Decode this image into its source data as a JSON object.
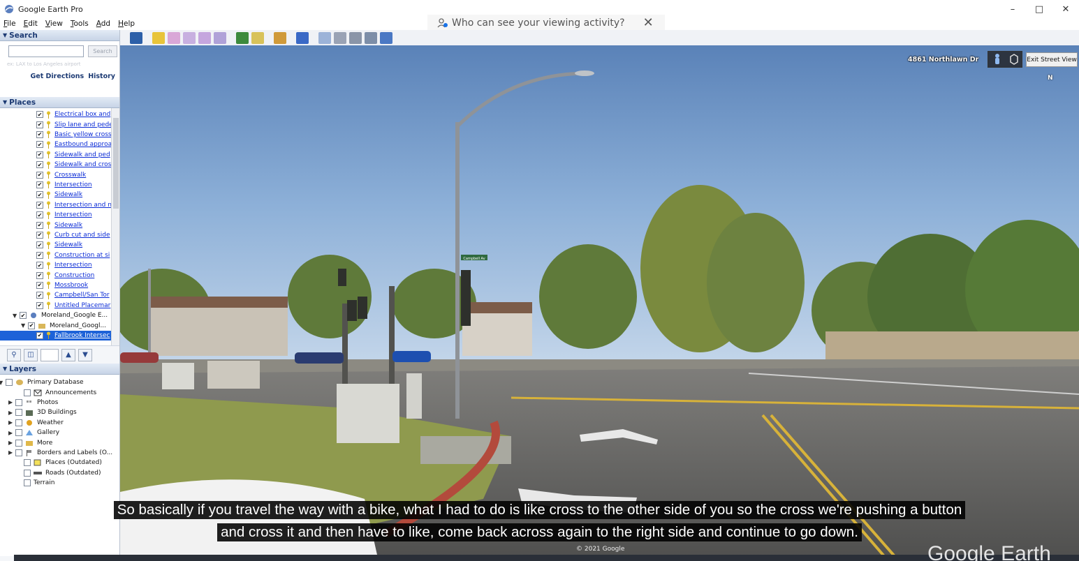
{
  "window": {
    "title": "Google Earth Pro",
    "controls": [
      "–",
      "□",
      "✕"
    ]
  },
  "menu": [
    {
      "u": "F",
      "rest": "ile"
    },
    {
      "u": "E",
      "rest": "dit"
    },
    {
      "u": "V",
      "rest": "iew"
    },
    {
      "u": "T",
      "rest": "ools"
    },
    {
      "u": "A",
      "rest": "dd"
    },
    {
      "u": "H",
      "rest": "elp"
    }
  ],
  "notice": {
    "text": "Who can see your viewing activity?",
    "close": "✕"
  },
  "search": {
    "header": "Search",
    "button": "Search",
    "hint": "ex: LAX to Los Angeles airport",
    "links": [
      "Get Directions",
      "History"
    ]
  },
  "places": {
    "header": "Places",
    "items": [
      "Electrical box and",
      "Slip lane and pede",
      "Basic yellow cross",
      "Eastbound approa",
      "Sidewalk and ped",
      "Sidewalk and cros",
      "Crosswalk",
      "Intersection",
      "Sidewalk",
      "Intersection and n",
      "Intersection",
      "Sidewalk",
      "Curb cut and side",
      "Sidewalk",
      "Construction at si",
      "Intersection",
      "Construction",
      "Mossbrook",
      "Campbell/San Tor",
      "Untitled Placemar"
    ],
    "folders": [
      "Moreland_Google E...",
      "Moreland_Googl..."
    ],
    "selected": "Fallbrook Intersec"
  },
  "layers": {
    "header": "Layers",
    "items": [
      "Primary Database",
      "Announcements",
      "Photos",
      "3D Buildings",
      "Weather",
      "Gallery",
      "More",
      "Borders and Labels (O...",
      "Places (Outdated)",
      "Roads (Outdated)",
      "Terrain"
    ]
  },
  "streetview": {
    "address": "4861 Northlawn Dr",
    "exit": "Exit Street View",
    "compass": "N",
    "street_sign": "Campbell Av"
  },
  "captions": {
    "line1": "So basically if you travel the way with a bike, what I had to do is like cross to the other side of you so the cross we're pushing a button",
    "line2": "and cross it and then have to like, come back across again to the right side and continue to go down."
  },
  "copyright": "© 2021 Google",
  "logo": "Google Earth",
  "colors": {
    "accent": "#1d62d8",
    "link": "#0a2bd6",
    "header_text": "#1c3a73"
  }
}
